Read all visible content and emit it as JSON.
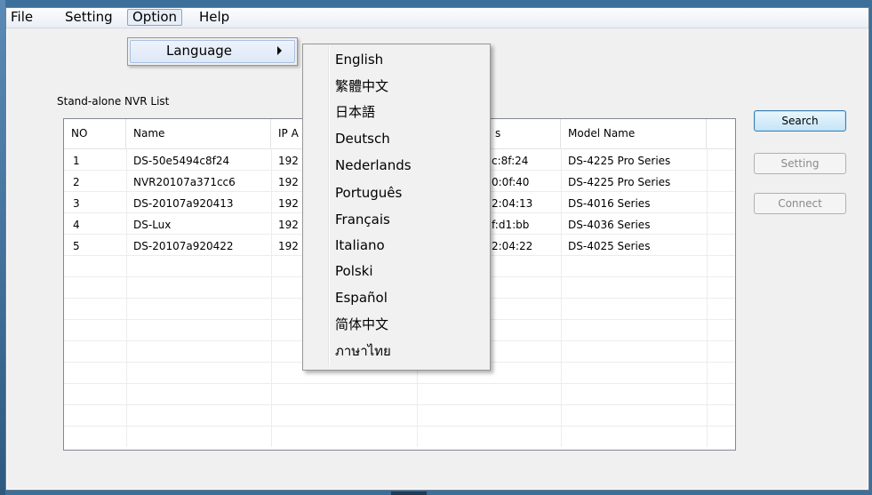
{
  "menubar": {
    "items": [
      "File",
      "Setting",
      "Option",
      "Help"
    ]
  },
  "option_menu": {
    "language_label": "Language"
  },
  "language_menu": {
    "items": [
      "English",
      "繁體中文",
      "日本語",
      "Deutsch",
      "Nederlands",
      "Português",
      "Français",
      "Italiano",
      "Polski",
      "Español",
      "简体中文",
      "ภาษาไทย"
    ]
  },
  "list": {
    "title": "Stand-alone NVR List",
    "columns": [
      "NO",
      "Name",
      "IP A",
      "",
      "s",
      "Model Name"
    ],
    "rows": [
      {
        "no": "1",
        "name": "DS-50e5494c8f24",
        "ip": "192",
        "mac": "c:8f:24",
        "model": "DS-4225 Pro Series"
      },
      {
        "no": "2",
        "name": "NVR20107a371cc6",
        "ip": "192",
        "mac": "0:0f:40",
        "model": "DS-4225 Pro Series"
      },
      {
        "no": "3",
        "name": "DS-20107a920413",
        "ip": "192",
        "mac": "2:04:13",
        "model": "DS-4016 Series"
      },
      {
        "no": "4",
        "name": "DS-Lux",
        "ip": "192",
        "mac": "f:d1:bb",
        "model": "DS-4036 Series"
      },
      {
        "no": "5",
        "name": "DS-20107a920422",
        "ip": "192",
        "mac": "2:04:22",
        "model": "DS-4025 Series"
      }
    ]
  },
  "buttons": {
    "search": "Search",
    "setting": "Setting",
    "connect": "Connect"
  }
}
